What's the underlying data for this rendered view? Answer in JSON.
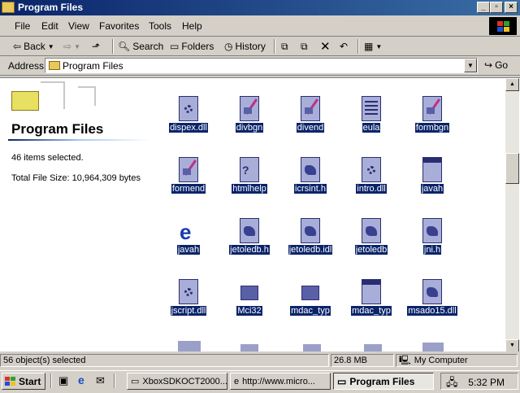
{
  "window": {
    "title": "Program Files"
  },
  "menu": [
    "File",
    "Edit",
    "View",
    "Favorites",
    "Tools",
    "Help"
  ],
  "toolbar": {
    "back": "Back",
    "search": "Search",
    "folders": "Folders",
    "history": "History"
  },
  "address": {
    "label": "Address",
    "value": "Program Files",
    "go": "Go"
  },
  "left_pane": {
    "title": "Program Files",
    "selected": "46 items selected.",
    "total_size": "Total File Size: 10,964,309 bytes"
  },
  "files": [
    {
      "name": "dispex.dll"
    },
    {
      "name": "divbgn"
    },
    {
      "name": "divend"
    },
    {
      "name": "eula"
    },
    {
      "name": "formbgn"
    },
    {
      "name": "formend"
    },
    {
      "name": "htmlhelp"
    },
    {
      "name": "icrsint.h"
    },
    {
      "name": "intro.dll"
    },
    {
      "name": "javah"
    },
    {
      "name": "javah"
    },
    {
      "name": "jetoledb.h"
    },
    {
      "name": "jetoledb.idl"
    },
    {
      "name": "jetoledb"
    },
    {
      "name": "jni.h"
    },
    {
      "name": "jscript.dll"
    },
    {
      "name": "Mci32"
    },
    {
      "name": "mdac_typ"
    },
    {
      "name": "mdac_typ"
    },
    {
      "name": "msado15.dll"
    }
  ],
  "status": {
    "objects": "56 object(s) selected",
    "size": "26.8 MB",
    "location": "My Computer"
  },
  "taskbar": {
    "start": "Start",
    "tasks": [
      "XboxSDKOCT2000...",
      "http://www.micro...",
      "Program Files"
    ],
    "clock": "5:32 PM"
  },
  "colors": {
    "titlebar": "#0a246a",
    "selection": "#0a246a",
    "chrome": "#d4d0c8"
  }
}
